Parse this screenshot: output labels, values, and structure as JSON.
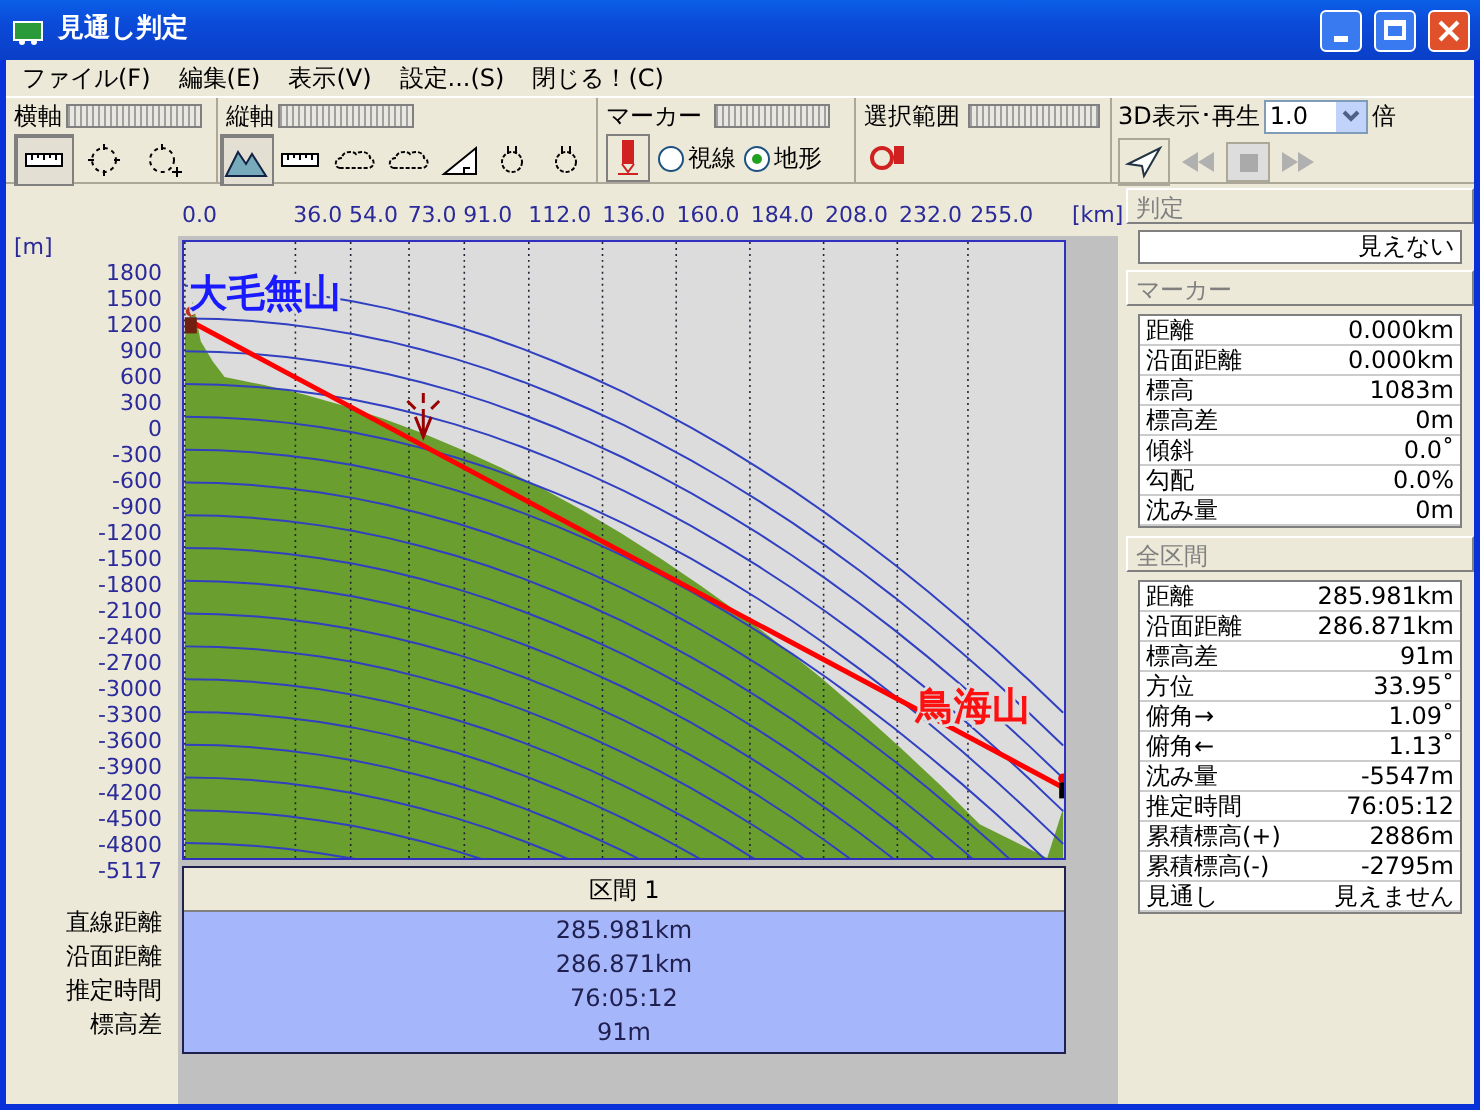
{
  "window": {
    "title": "見通し判定"
  },
  "menu": [
    "ファイル(F)",
    "編集(E)",
    "表示(V)",
    "設定...(S)",
    "閉じる！(C)"
  ],
  "toolbar": {
    "horizontal_axis": {
      "label": "横軸",
      "tools": [
        {
          "kind": "ruler",
          "selected": true
        },
        {
          "kind": "dotted-circle",
          "selected": false
        },
        {
          "kind": "dotted-circle-plus",
          "selected": false
        }
      ]
    },
    "vertical_axis": {
      "label": "縦軸",
      "tools": [
        {
          "kind": "mountain",
          "selected": true
        },
        {
          "kind": "ruler",
          "selected": false
        },
        {
          "kind": "cloud",
          "selected": false
        },
        {
          "kind": "cloud",
          "selected": false
        },
        {
          "kind": "triangle",
          "selected": false
        },
        {
          "kind": "plug",
          "selected": false
        },
        {
          "kind": "plug",
          "selected": false
        }
      ]
    },
    "marker": {
      "label": "マーカー",
      "options": [
        {
          "label": "視線",
          "selected": false
        },
        {
          "label": "地形",
          "selected": true
        }
      ]
    },
    "range": {
      "label": "選択範囲"
    },
    "playback": {
      "label": "3D表示･再生",
      "speed": "1.0",
      "unit": "倍"
    }
  },
  "chart": {
    "x_unit": "[km]",
    "y_unit": "[m]",
    "x_ticks": [
      "0.0",
      "36.0",
      "54.0",
      "73.0",
      "91.0",
      "112.0",
      "136.0",
      "160.0",
      "184.0",
      "208.0",
      "232.0",
      "255.0"
    ],
    "y_ticks": [
      "1800",
      "1500",
      "1200",
      "900",
      "600",
      "300",
      "0",
      "-300",
      "-600",
      "-900",
      "-1200",
      "-1500",
      "-1800",
      "-2100",
      "-2400",
      "-2700",
      "-3000",
      "-3300",
      "-3600",
      "-3900",
      "-4200",
      "-4500",
      "-4800",
      "-5117"
    ],
    "start_label": "大毛無山",
    "end_label": "鳥海山"
  },
  "section_table": {
    "header": "区間 1",
    "rows": [
      {
        "label": "直線距離",
        "value": "285.981km"
      },
      {
        "label": "沿面距離",
        "value": "286.871km"
      },
      {
        "label": "推定時間",
        "value": "76:05:12"
      },
      {
        "label": "標高差",
        "value": "91m"
      }
    ]
  },
  "judgement": {
    "title": "判定",
    "value": "見えない"
  },
  "marker_panel": {
    "title": "マーカー",
    "rows": [
      {
        "label": "距離",
        "value": "0.000km"
      },
      {
        "label": "沿面距離",
        "value": "0.000km"
      },
      {
        "label": "標高",
        "value": "1083m"
      },
      {
        "label": "標高差",
        "value": "0m"
      },
      {
        "label": "傾斜",
        "value": "0.0˚"
      },
      {
        "label": "勾配",
        "value": "0.0%"
      },
      {
        "label": "沈み量",
        "value": "0m"
      }
    ]
  },
  "total_panel": {
    "title": "全区間",
    "rows": [
      {
        "label": "距離",
        "value": "285.981km"
      },
      {
        "label": "沿面距離",
        "value": "286.871km"
      },
      {
        "label": "標高差",
        "value": "91m"
      },
      {
        "label": "方位",
        "value": "33.95˚"
      },
      {
        "label": "俯角→",
        "value": "1.09˚"
      },
      {
        "label": "俯角←",
        "value": "1.13˚"
      },
      {
        "label": "沈み量",
        "value": "-5547m"
      },
      {
        "label": "推定時間",
        "value": "76:05:12"
      },
      {
        "label": "累積標高(+)",
        "value": "2886m"
      },
      {
        "label": "累積標高(-)",
        "value": "-2795m"
      },
      {
        "label": "見通し",
        "value": "見えません"
      }
    ]
  }
}
